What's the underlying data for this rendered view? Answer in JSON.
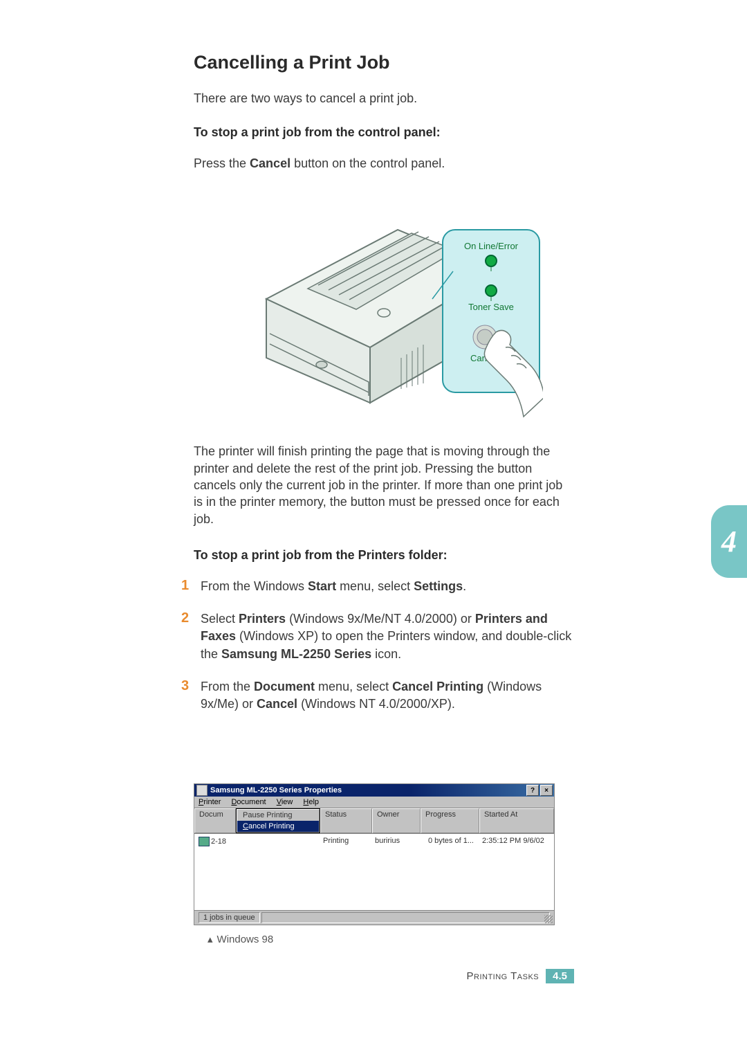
{
  "heading": "Cancelling a Print Job",
  "intro": "There are two ways to cancel a print job.",
  "sub1": "To stop a print job from the control panel:",
  "para1_pre": "Press the ",
  "para1_bold": "Cancel",
  "para1_post": " button on the control panel.",
  "printer_labels": {
    "online": "On Line/Error",
    "toner": "Toner Save",
    "cancel": "Cancel"
  },
  "chapter_tab": "4",
  "para2": "The printer will finish printing the page that is moving through the printer and delete the rest of the print job. Pressing the button cancels only the current job in the printer. If more than one print job is in the printer memory, the button must be pressed once for each job.",
  "sub2": "To stop a print job from the Printers folder:",
  "steps": {
    "n1": "1",
    "s1_a": "From the Windows ",
    "s1_b": "Start",
    "s1_c": " menu, select ",
    "s1_d": "Settings",
    "s1_e": ".",
    "n2": "2",
    "s2_a": "Select ",
    "s2_b": "Printers",
    "s2_c": " (Windows 9x/Me/NT 4.0/2000) or ",
    "s2_d": "Printers and Faxes",
    "s2_e": " (Windows XP) to open the Printers window, and double-click the ",
    "s2_f": "Samsung ML-2250 Series",
    "s2_g": " icon.",
    "n3": "3",
    "s3_a": "From the ",
    "s3_b": "Document",
    "s3_c": " menu, select ",
    "s3_d": "Cancel Printing",
    "s3_e": " (Windows 9x/Me) or ",
    "s3_f": "Cancel",
    "s3_g": " (Windows NT 4.0/2000/XP)."
  },
  "dialog": {
    "title": "Samsung ML-2250 Series Properties",
    "help": "?",
    "close": "×",
    "menu": {
      "printer": "Printer",
      "document": "Document",
      "view": "View",
      "help": "Help"
    },
    "docmenu": {
      "pause": "Pause Printing",
      "cancel": "Cancel Printing"
    },
    "headers": {
      "doc": "Docum",
      "status": "Status",
      "owner": "Owner",
      "progress": "Progress",
      "started": "Started At"
    },
    "row": {
      "name": "2-18",
      "status": "Printing",
      "owner": "buririus",
      "progress": "0 bytes of 1...",
      "started": "2:35:12 PM 9/6/02"
    },
    "statusbar": "1 jobs in queue"
  },
  "caption_tri": "▴",
  "caption": "Windows 98",
  "footer": {
    "label": "Printing Tasks",
    "chapter": "4.",
    "page": "5"
  }
}
